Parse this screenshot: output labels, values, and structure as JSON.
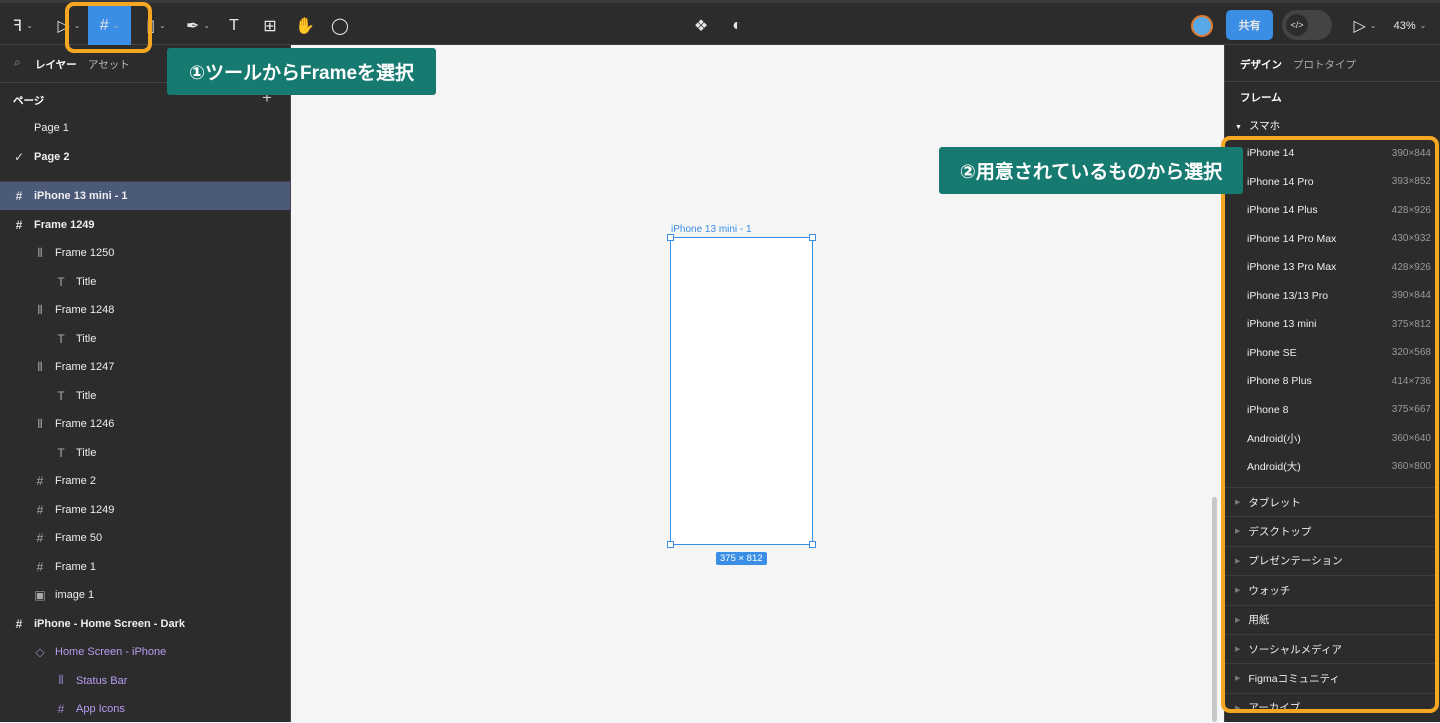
{
  "toolbar": {
    "zoom": "43%",
    "share": "共有",
    "code_icon": "</>"
  },
  "left": {
    "tabs": [
      "レイヤー",
      "アセット"
    ],
    "pages_title": "ページ",
    "pages": [
      {
        "label": "Page 1",
        "checked": false
      },
      {
        "label": "Page 2",
        "checked": true
      }
    ],
    "layers": [
      {
        "label": "iPhone 13 mini - 1",
        "icon": "#",
        "level": 0,
        "bold": true,
        "selected": true
      },
      {
        "label": "Frame 1249",
        "icon": "#",
        "level": 0,
        "bold": true
      },
      {
        "label": "Frame 1250",
        "icon": "|||",
        "level": 1
      },
      {
        "label": "Title",
        "icon": "T",
        "level": 2
      },
      {
        "label": "Frame 1248",
        "icon": "|||",
        "level": 1
      },
      {
        "label": "Title",
        "icon": "T",
        "level": 2
      },
      {
        "label": "Frame 1247",
        "icon": "|||",
        "level": 1
      },
      {
        "label": "Title",
        "icon": "T",
        "level": 2
      },
      {
        "label": "Frame 1246",
        "icon": "|||",
        "level": 1
      },
      {
        "label": "Title",
        "icon": "T",
        "level": 2
      },
      {
        "label": "Frame 2",
        "icon": "#",
        "level": 1
      },
      {
        "label": "Frame 1249",
        "icon": "#",
        "level": 1
      },
      {
        "label": "Frame 50",
        "icon": "#",
        "level": 1
      },
      {
        "label": "Frame 1",
        "icon": "#",
        "level": 1
      },
      {
        "label": "image 1",
        "icon": "▣",
        "level": 1
      },
      {
        "label": "iPhone - Home Screen - Dark",
        "icon": "#",
        "level": 0,
        "bold": true
      },
      {
        "label": "Home Screen - iPhone",
        "icon": "◇",
        "level": 1,
        "purple": true
      },
      {
        "label": "Status Bar",
        "icon": "|||",
        "level": 2,
        "purple": true
      },
      {
        "label": "App Icons",
        "icon": "#",
        "level": 2,
        "purple": true
      }
    ]
  },
  "canvas": {
    "frame_label": "iPhone 13 mini - 1",
    "size_badge": "375 × 812"
  },
  "right": {
    "tabs": [
      "デザイン",
      "プロトタイプ"
    ],
    "section": "フレーム",
    "group": "スマホ",
    "presets": [
      [
        "iPhone 14",
        "390×844"
      ],
      [
        "iPhone 14 Pro",
        "393×852"
      ],
      [
        "iPhone 14 Plus",
        "428×926"
      ],
      [
        "iPhone 14 Pro Max",
        "430×932"
      ],
      [
        "iPhone 13 Pro Max",
        "428×926"
      ],
      [
        "iPhone 13/13 Pro",
        "390×844"
      ],
      [
        "iPhone 13 mini",
        "375×812"
      ],
      [
        "iPhone SE",
        "320×568"
      ],
      [
        "iPhone 8 Plus",
        "414×736"
      ],
      [
        "iPhone 8",
        "375×667"
      ],
      [
        "Android(小)",
        "360×640"
      ],
      [
        "Android(大)",
        "360×800"
      ]
    ],
    "categories": [
      "タブレット",
      "デスクトップ",
      "プレゼンテーション",
      "ウォッチ",
      "用紙",
      "ソーシャルメディア",
      "Figmaコミュニティ",
      "アーカイブ"
    ]
  },
  "annotations": {
    "step1": "①ツールからFrameを選択",
    "step2": "②用意されているものから選択",
    "accent": "#f5a623",
    "callout_bg": "#177a70"
  }
}
